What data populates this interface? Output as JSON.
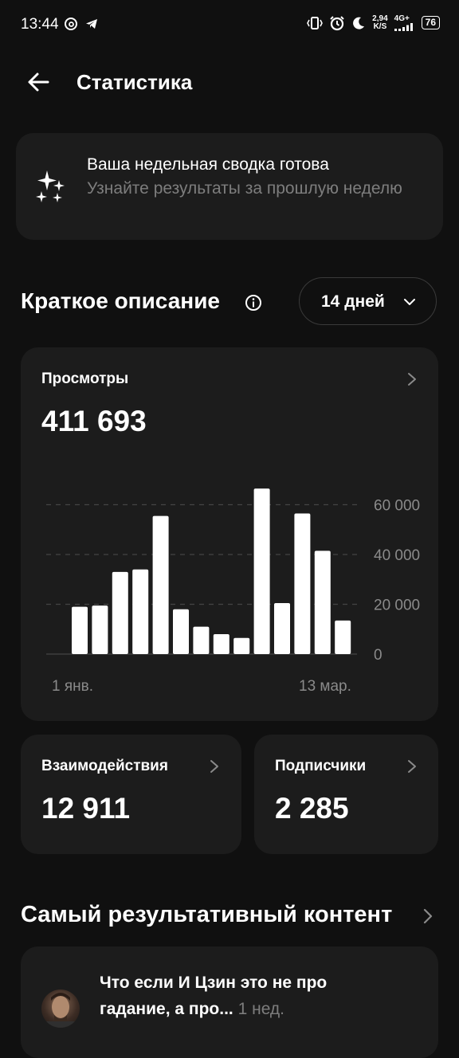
{
  "status_bar": {
    "time": "13:44",
    "net_speed_value": "2,94",
    "net_speed_unit": "K/S",
    "network": "4G+",
    "battery": "76"
  },
  "header": {
    "title": "Статистика",
    "back_icon": "arrow-left-icon"
  },
  "banner": {
    "icon": "sparkles-icon",
    "title": "Ваша недельная сводка готова",
    "subtitle": "Узнайте результаты за прошлую неделю"
  },
  "summary": {
    "title": "Краткое описание",
    "period": "14 дней"
  },
  "views": {
    "label": "Просмотры",
    "total": "411 693"
  },
  "chart_data": {
    "type": "bar",
    "values": [
      19000,
      19500,
      33000,
      34000,
      55500,
      18000,
      11000,
      8000,
      6500,
      66500,
      20500,
      56500,
      41500,
      13500
    ],
    "x_tick_labels": [
      "1 янв.",
      "13 мар."
    ],
    "y_ticks": [
      0,
      20000,
      40000,
      60000
    ],
    "y_tick_labels": [
      "0",
      "20 000",
      "40 000",
      "60 000"
    ],
    "ylim": [
      0,
      70000
    ],
    "bar_color": "#ffffff",
    "grid": true
  },
  "interactions": {
    "label": "Взаимодействия",
    "value": "12 911"
  },
  "followers": {
    "label": "Подписчики",
    "value": "2 285"
  },
  "top_content": {
    "title": "Самый результативный контент",
    "post_text": "Что если И Цзин это не про гадание, а про...",
    "post_time": "1 нед."
  }
}
